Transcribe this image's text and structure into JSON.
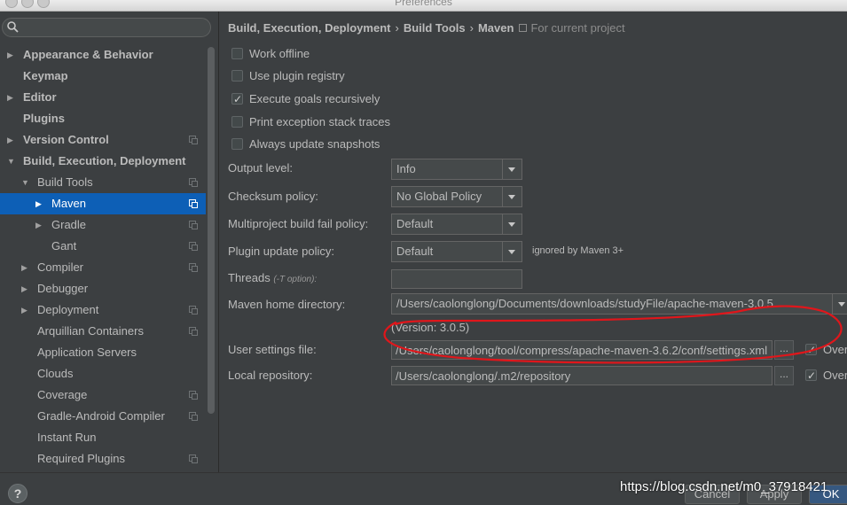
{
  "window": {
    "title": "Preferences"
  },
  "sidebar": {
    "search_placeholder": "",
    "items": [
      {
        "label": "Appearance & Behavior",
        "level": 0,
        "arrow": "right",
        "bold": true,
        "icon": false
      },
      {
        "label": "Keymap",
        "level": 0,
        "arrow": "none",
        "bold": true,
        "icon": false
      },
      {
        "label": "Editor",
        "level": 0,
        "arrow": "right",
        "bold": true,
        "icon": false
      },
      {
        "label": "Plugins",
        "level": 0,
        "arrow": "none",
        "bold": true,
        "icon": false
      },
      {
        "label": "Version Control",
        "level": 0,
        "arrow": "right",
        "bold": true,
        "icon": true
      },
      {
        "label": "Build, Execution, Deployment",
        "level": 0,
        "arrow": "down",
        "bold": true,
        "icon": false
      },
      {
        "label": "Build Tools",
        "level": 1,
        "arrow": "down",
        "bold": false,
        "icon": true
      },
      {
        "label": "Maven",
        "level": 2,
        "arrow": "right",
        "bold": false,
        "icon": true,
        "selected": true
      },
      {
        "label": "Gradle",
        "level": 2,
        "arrow": "right",
        "bold": false,
        "icon": true
      },
      {
        "label": "Gant",
        "level": 2,
        "arrow": "none",
        "bold": false,
        "icon": true
      },
      {
        "label": "Compiler",
        "level": 1,
        "arrow": "right",
        "bold": false,
        "icon": true
      },
      {
        "label": "Debugger",
        "level": 1,
        "arrow": "right",
        "bold": false,
        "icon": false
      },
      {
        "label": "Deployment",
        "level": 1,
        "arrow": "right",
        "bold": false,
        "icon": true
      },
      {
        "label": "Arquillian Containers",
        "level": 1,
        "arrow": "none",
        "bold": false,
        "icon": true
      },
      {
        "label": "Application Servers",
        "level": 1,
        "arrow": "none",
        "bold": false,
        "icon": false
      },
      {
        "label": "Clouds",
        "level": 1,
        "arrow": "none",
        "bold": false,
        "icon": false
      },
      {
        "label": "Coverage",
        "level": 1,
        "arrow": "none",
        "bold": false,
        "icon": true
      },
      {
        "label": "Gradle-Android Compiler",
        "level": 1,
        "arrow": "none",
        "bold": false,
        "icon": true
      },
      {
        "label": "Instant Run",
        "level": 1,
        "arrow": "none",
        "bold": false,
        "icon": false
      },
      {
        "label": "Required Plugins",
        "level": 1,
        "arrow": "none",
        "bold": false,
        "icon": true
      }
    ]
  },
  "breadcrumb": {
    "parts": [
      "Build, Execution, Deployment",
      "Build Tools",
      "Maven"
    ],
    "separator": "›",
    "scope": "For current project"
  },
  "checkboxes": [
    {
      "label": "Work offline",
      "checked": false
    },
    {
      "label": "Use plugin registry",
      "checked": false
    },
    {
      "label": "Execute goals recursively",
      "checked": true
    },
    {
      "label": "Print exception stack traces",
      "checked": false
    },
    {
      "label": "Always update snapshots",
      "checked": false
    }
  ],
  "form": {
    "output_level": {
      "label": "Output level:",
      "value": "Info"
    },
    "checksum_policy": {
      "label": "Checksum policy:",
      "value": "No Global Policy"
    },
    "multiproject_fail_policy": {
      "label": "Multiproject build fail policy:",
      "value": "Default"
    },
    "plugin_update_policy": {
      "label": "Plugin update policy:",
      "value": "Default",
      "note": "ignored by Maven 3+"
    },
    "threads": {
      "label": "Threads",
      "hint": "(-T option):",
      "value": ""
    },
    "maven_home": {
      "label": "Maven home directory:",
      "value": "/Users/caolonglong/Documents/downloads/studyFile/apache-maven-3.0.5",
      "version": "(Version: 3.0.5)"
    },
    "user_settings": {
      "label": "User settings file:",
      "value": "/Users/caolonglong/tool/compress/apache-maven-3.6.2/conf/settings.xml",
      "browse": "...",
      "override_label": "Override",
      "override_checked": true
    },
    "local_repository": {
      "label": "Local repository:",
      "value": "/Users/caolonglong/.m2/repository",
      "browse": "...",
      "override_label": "Override",
      "override_checked": true
    }
  },
  "footer": {
    "help": "?",
    "cancel": "Cancel",
    "apply": "Apply",
    "ok": "OK",
    "watermark": "https://blog.csdn.net/m0_37918421"
  },
  "colors": {
    "background": "#3c3f41",
    "selection": "#0d5fb6",
    "annotation": "#e0161b"
  }
}
